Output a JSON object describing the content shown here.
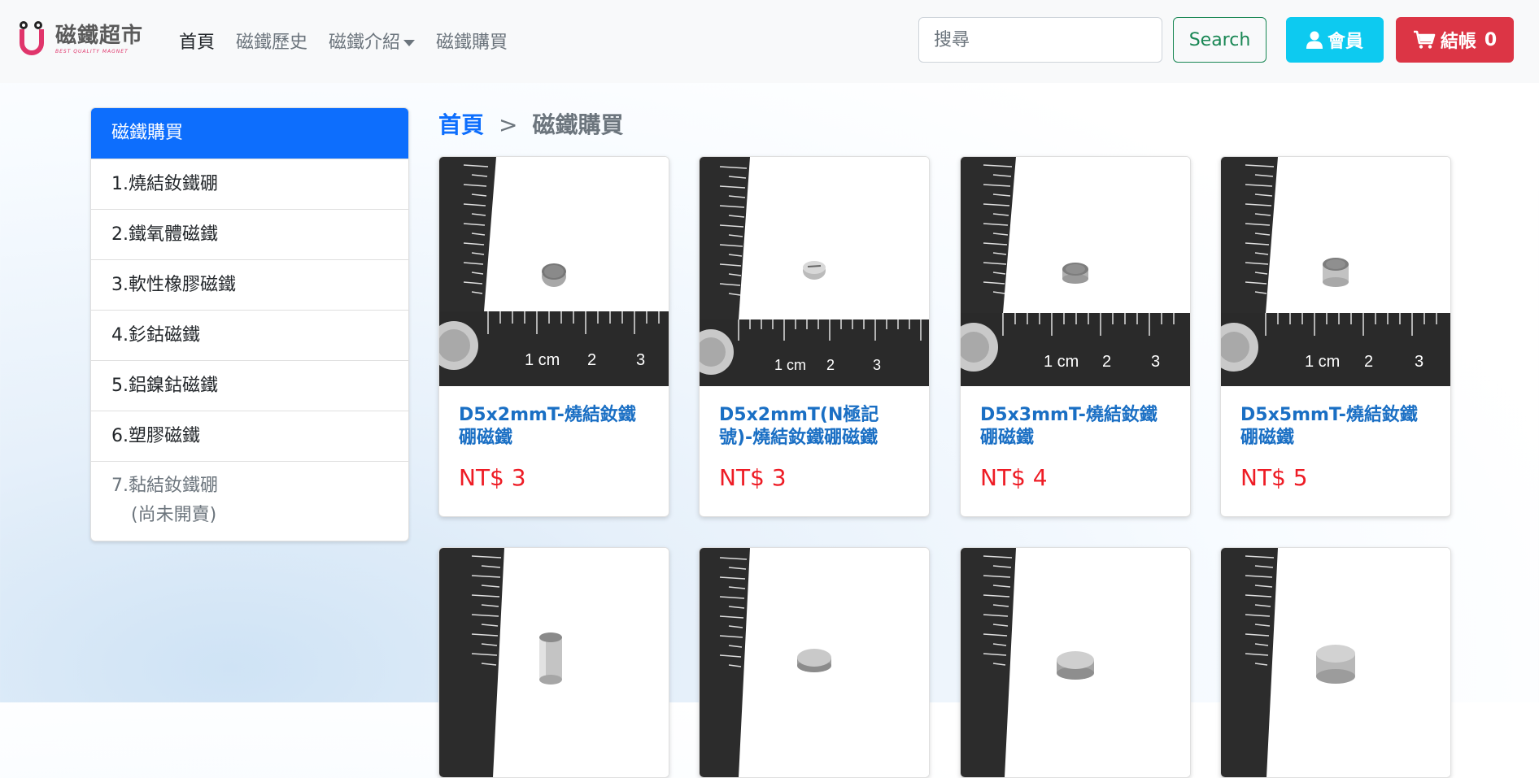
{
  "brand": {
    "name": "磁鐵超市",
    "tagline": "BEST QUALITY MAGNET"
  },
  "nav": {
    "items": [
      {
        "label": "首頁",
        "active": true
      },
      {
        "label": "磁鐵歷史"
      },
      {
        "label": "磁鐵介紹",
        "dropdown": true
      },
      {
        "label": "磁鐵購買"
      }
    ]
  },
  "search": {
    "placeholder": "搜尋",
    "button_label": "Search"
  },
  "member": {
    "label": "會員",
    "icon": "user-icon"
  },
  "cart": {
    "label": "結帳",
    "count": "0",
    "icon": "cart-icon"
  },
  "sidebar": {
    "header": "磁鐵購買",
    "items": [
      "1.燒結釹鐵硼",
      "2.鐵氧體磁鐵",
      "3.軟性橡膠磁鐵",
      "4.釤鈷磁鐵",
      "5.鋁鎳鈷磁鐵",
      "6.塑膠磁鐵"
    ],
    "disabled_item": {
      "label": "7.黏結釹鐵硼",
      "note": "(尚未開賣)"
    }
  },
  "breadcrumb": {
    "home": "首頁",
    "separator": ">",
    "current": "磁鐵購買"
  },
  "products": [
    {
      "title": "D5x2mmT-燒結釹鐵硼磁鐵",
      "price": "NT$ 3"
    },
    {
      "title": "D5x2mmT(N極記號)-燒結釹鐵硼磁鐵",
      "price": "NT$ 3"
    },
    {
      "title": "D5x3mmT-燒結釹鐵硼磁鐵",
      "price": "NT$ 4"
    },
    {
      "title": "D5x5mmT-燒結釹鐵硼磁鐵",
      "price": "NT$ 5"
    }
  ],
  "ruler": {
    "cm_label": "1 cm",
    "ticks": [
      "2",
      "3"
    ]
  },
  "colors": {
    "primary": "#0d6efd",
    "success": "#198754",
    "info": "#0dcaf0",
    "danger": "#dc3545",
    "price": "#ee1c25",
    "brand_pink": "#e0356b"
  }
}
